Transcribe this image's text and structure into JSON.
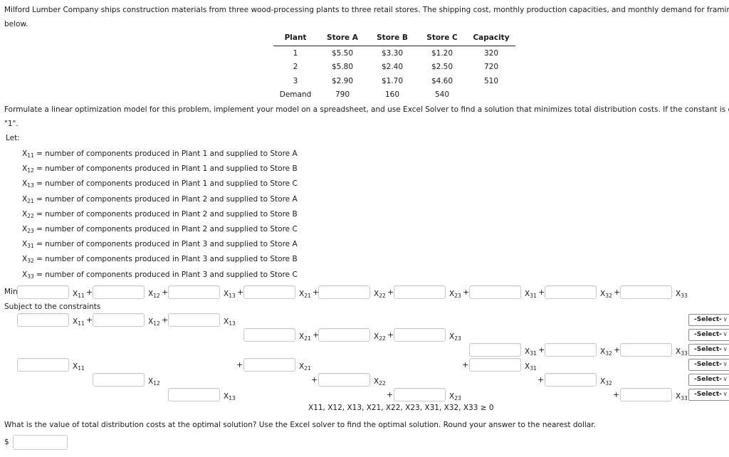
{
  "intro": {
    "line1": "Milford Lumber Company ships construction materials from three wood-processing plants to three retail stores. The shipping cost, monthly production capacities, and monthly demand for framing lun",
    "line2": "below."
  },
  "table": {
    "headers": [
      "Plant",
      "Store A",
      "Store B",
      "Store C",
      "Capacity"
    ],
    "rows": [
      [
        "1",
        "$5.50",
        "$3.30",
        "$1.20",
        "320"
      ],
      [
        "2",
        "$5.80",
        "$2.40",
        "$2.50",
        "720"
      ],
      [
        "3",
        "$2.90",
        "$1.70",
        "$4.60",
        "510"
      ],
      [
        "Demand",
        "790",
        "160",
        "540",
        ""
      ]
    ]
  },
  "instructions": {
    "line1": "Formulate a linear optimization model for this problem, implement your model on a spreadsheet, and use Excel Solver to find a solution that minimizes total distribution costs. If the constant is equal t",
    "line2": "\"1\"."
  },
  "let_label": "Let:",
  "definitions": [
    {
      "var": "X",
      "sub": "11",
      "text": " = number of components produced in Plant 1 and supplied to Store A"
    },
    {
      "var": "X",
      "sub": "12",
      "text": " = number of components produced in Plant 1 and supplied to Store B"
    },
    {
      "var": "X",
      "sub": "13",
      "text": " = number of components produced in Plant 1 and supplied to Store C"
    },
    {
      "var": "X",
      "sub": "21",
      "text": " = number of components produced in Plant 2 and supplied to Store A"
    },
    {
      "var": "X",
      "sub": "22",
      "text": " = number of components produced in Plant 2 and supplied to Store B"
    },
    {
      "var": "X",
      "sub": "23",
      "text": " = number of components produced in Plant 2 and supplied to Store C"
    },
    {
      "var": "X",
      "sub": "31",
      "text": " = number of components produced in Plant 3 and supplied to Store A"
    },
    {
      "var": "X",
      "sub": "32",
      "text": " = number of components produced in Plant 3 and supplied to Store B"
    },
    {
      "var": "X",
      "sub": "33",
      "text": " = number of components produced in Plant 3 and supplied to Store C"
    }
  ],
  "model": {
    "min_label": "Min",
    "subject_label": "Subject to the constraints",
    "plus": "+",
    "variables": [
      "11",
      "12",
      "13",
      "21",
      "22",
      "23",
      "31",
      "32",
      "33"
    ],
    "select_placeholder": "-Select-",
    "select_chevron": "∨",
    "nonnegativity": "X11, X12, X13, X21, X22, X23, X31, X32, X33 ≥ 0"
  },
  "question": {
    "text": "What is the value of total distribution costs at the optimal solution? Use the Excel solver to find the optimal solution. Round your answer to the nearest dollar.",
    "currency": "$",
    "answer_value": ""
  }
}
